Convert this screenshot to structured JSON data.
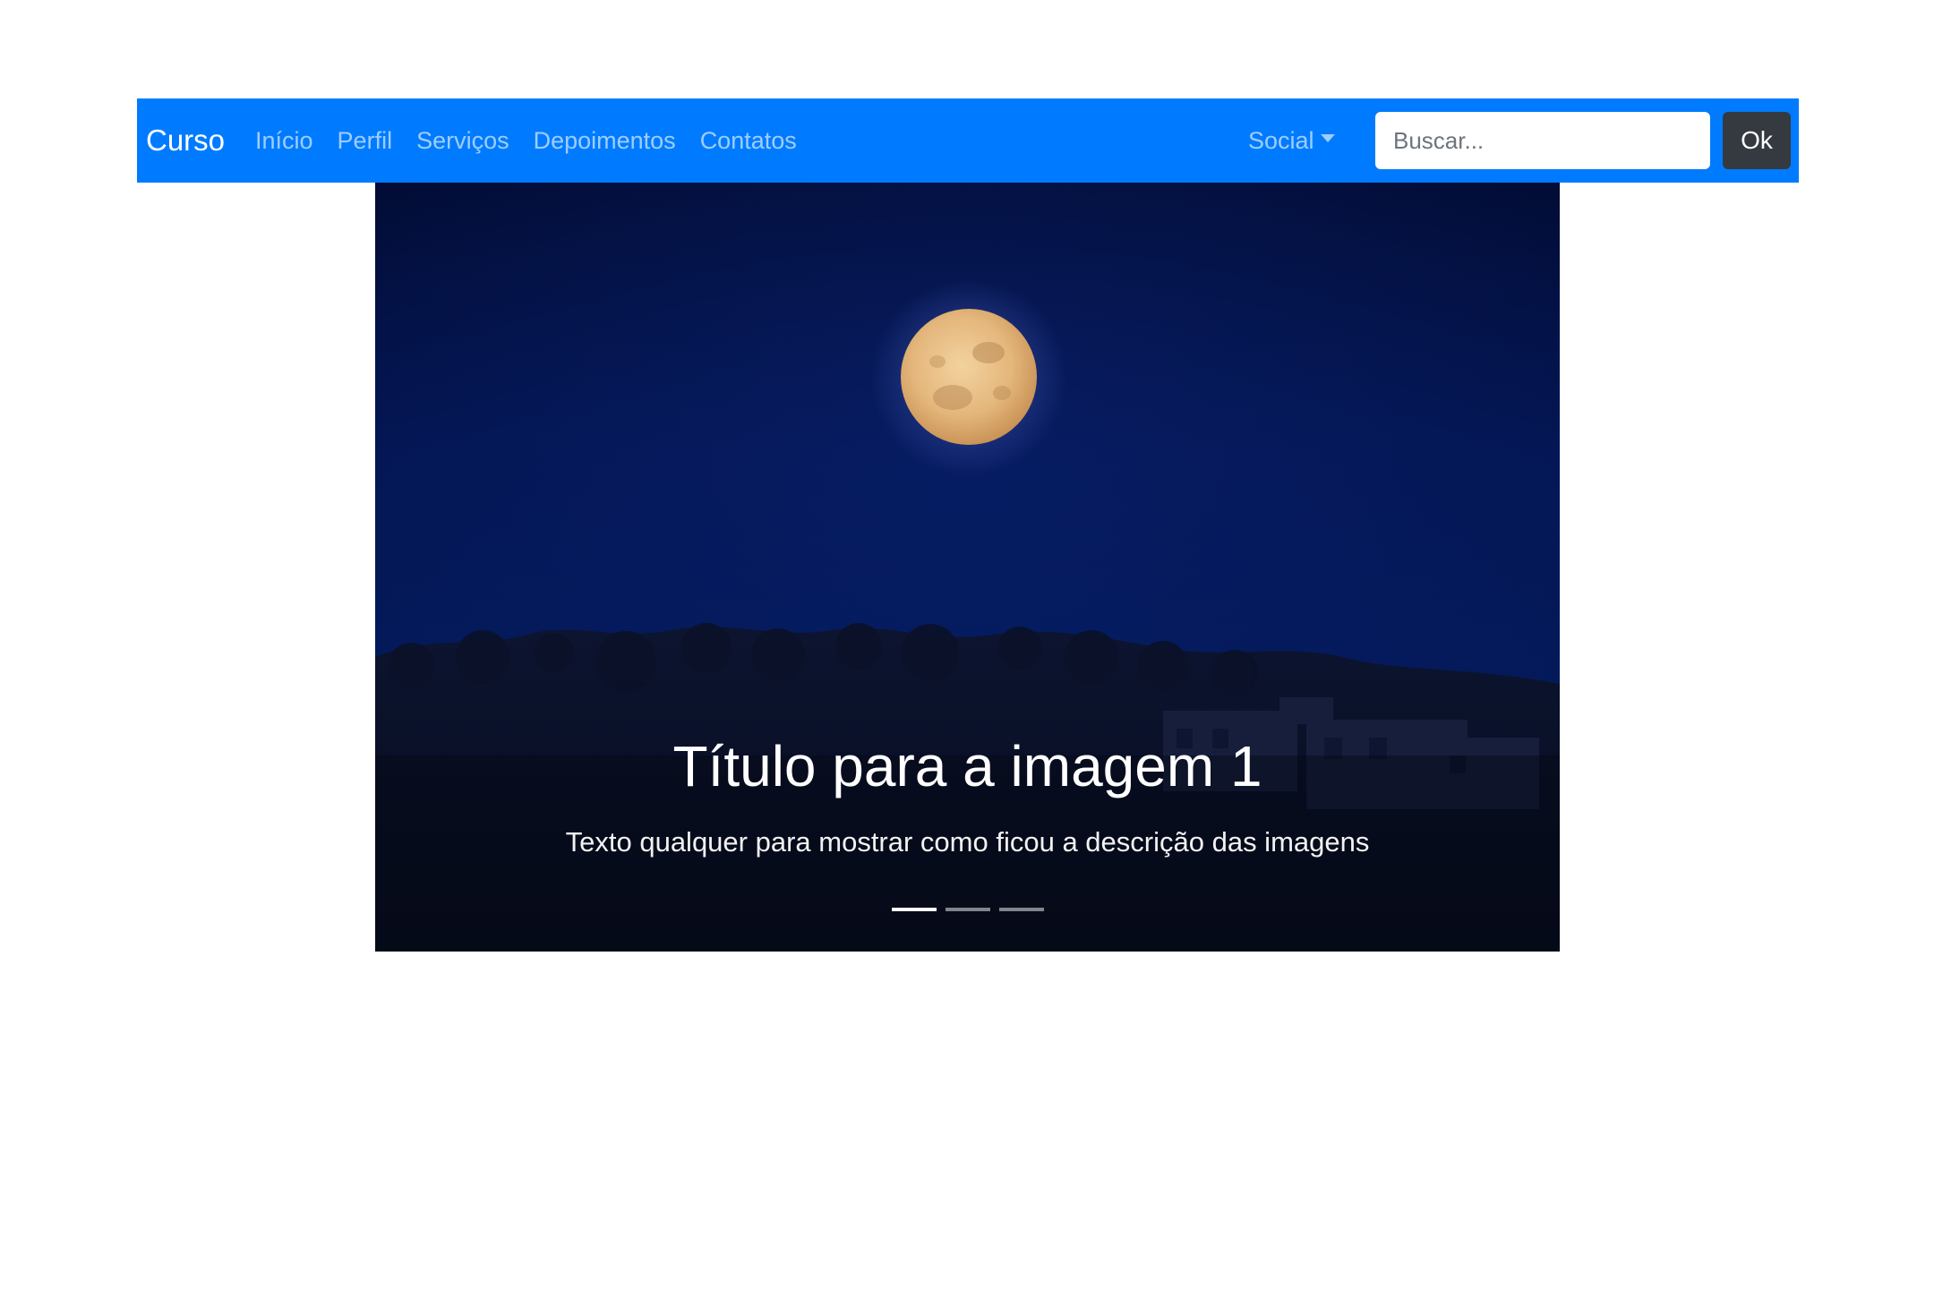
{
  "navbar": {
    "brand": "Curso",
    "links": [
      "Início",
      "Perfil",
      "Serviços",
      "Depoimentos",
      "Contatos"
    ],
    "dropdown_label": "Social",
    "search_placeholder": "Buscar...",
    "search_button": "Ok",
    "background_color": "#007bff"
  },
  "carousel": {
    "slide_title": "Título para a imagem 1",
    "slide_text": "Texto qualquer para mostrar como ficou a descrição das imagens",
    "image_subject": "full-moon-night-landscape",
    "indicator_count": 3,
    "active_indicator": 1
  }
}
